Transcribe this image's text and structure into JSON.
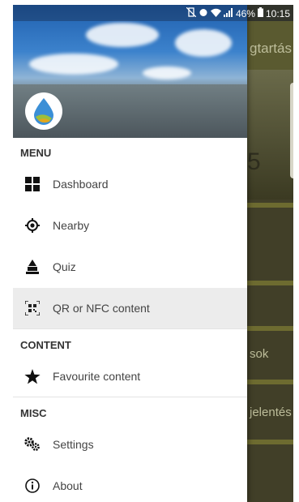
{
  "status_bar": {
    "battery": "46%",
    "time": "10:15"
  },
  "background_app": {
    "title_fragment": "gtartás",
    "number_fragment": "5",
    "row_fragment_1": "sok",
    "row_fragment_2": "jelentés"
  },
  "drawer": {
    "sections": [
      {
        "label": "MENU"
      },
      {
        "label": "CONTENT"
      },
      {
        "label": "MISC"
      }
    ],
    "items": [
      {
        "label": "Dashboard",
        "icon": "dashboard-icon"
      },
      {
        "label": "Nearby",
        "icon": "location-target-icon"
      },
      {
        "label": "Quiz",
        "icon": "quiz-icon"
      },
      {
        "label": "QR or NFC content",
        "icon": "qr-code-icon",
        "selected": true
      },
      {
        "label": "Favourite content",
        "icon": "star-icon"
      },
      {
        "label": "Settings",
        "icon": "gears-icon"
      },
      {
        "label": "About",
        "icon": "info-icon"
      }
    ]
  },
  "colors": {
    "drawer_bg": "#ffffff",
    "selected_bg": "#ececec",
    "text": "#444444",
    "scrim": "#413f28"
  }
}
